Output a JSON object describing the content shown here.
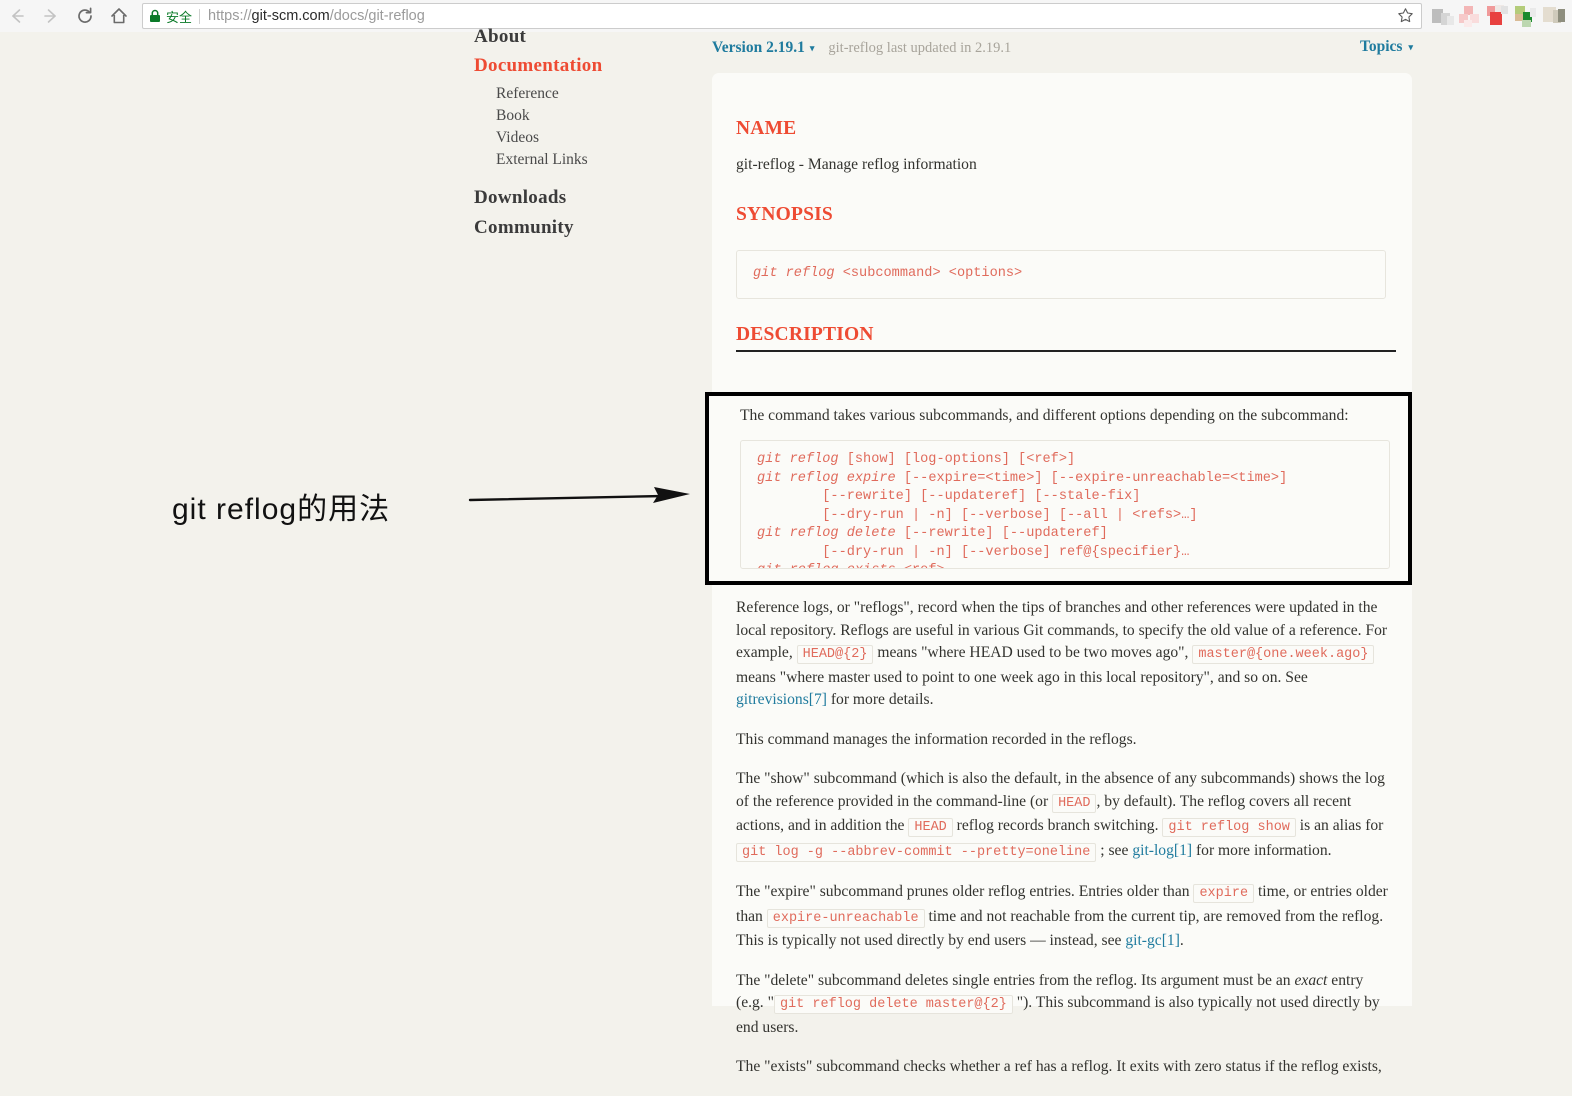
{
  "browser": {
    "back_icon": "back-arrow-icon",
    "forward_icon": "forward-arrow-icon",
    "reload_icon": "reload-icon",
    "home_icon": "home-icon",
    "lock_icon": "lock-icon",
    "secure_label": "安全",
    "url_prefix": "https://",
    "url_domain": "git-scm.com",
    "url_path": "/docs/git-reflog",
    "url_full": "https://git-scm.com/docs/git-reflog",
    "bookmark_icon": "star-icon"
  },
  "sidebar": {
    "items": [
      {
        "label": "About",
        "level": "top",
        "active": false
      },
      {
        "label": "Documentation",
        "level": "top",
        "active": true
      },
      {
        "label": "Reference",
        "level": "sub",
        "active": false
      },
      {
        "label": "Book",
        "level": "sub",
        "active": false
      },
      {
        "label": "Videos",
        "level": "sub",
        "active": false
      },
      {
        "label": "External Links",
        "level": "sub",
        "active": false
      },
      {
        "label": "Downloads",
        "level": "top",
        "active": false
      },
      {
        "label": "Community",
        "level": "top",
        "active": false
      }
    ]
  },
  "version_bar": {
    "version_label": "Version 2.19.1",
    "caret": "▾",
    "updated_note": "git-reflog last updated in 2.19.1",
    "topics_label": "Topics",
    "topics_caret": "▾"
  },
  "doc": {
    "name_heading": "NAME",
    "name_text": "git-reflog - Manage reflog information",
    "synopsis_heading": "SYNOPSIS",
    "synopsis_code_em": "git reflog",
    "synopsis_code_rest": " <subcommand> <options>",
    "description_heading": "DESCRIPTION",
    "description_intro": "The command takes various subcommands, and different options depending on the subcommand:",
    "description_code_lines": [
      "git reflog [show] [log-options] [<ref>]",
      "git reflog expire [--expire=<time>] [--expire-unreachable=<time>]",
      "        [--rewrite] [--updateref] [--stale-fix]",
      "        [--dry-run | -n] [--verbose] [--all | <refs>…]",
      "git reflog delete [--rewrite] [--updateref]",
      "        [--dry-run | -n] [--verbose] ref@{specifier}…",
      "git reflog exists <ref>"
    ],
    "para_reflogs": {
      "t1": "Reference logs, or \"reflogs\", record when the tips of branches and other references were updated in the local repository. Reflogs are useful in various Git commands, to specify the old value of a reference. For example, ",
      "c1": "HEAD@{2}",
      "t2": " means \"where HEAD used to be two moves ago\", ",
      "c2": "master@{one.week.ago}",
      "t3": " means \"where master used to point to one week ago in this local repository\", and so on. See ",
      "link": "gitrevisions[7]",
      "t4": " for more details."
    },
    "para_manages": "This command manages the information recorded in the reflogs.",
    "para_show": {
      "t1": "The \"show\" subcommand (which is also the default, in the absence of any subcommands) shows the log of the reference provided in the command-line (or ",
      "c1": "HEAD",
      "t2": ", by default). The reflog covers all recent actions, and in addition the ",
      "c2": "HEAD",
      "t3": " reflog records branch switching. ",
      "c3": "git reflog show",
      "t4": " is an alias for ",
      "c4": "git log -g --abbrev-commit --pretty=oneline",
      "t5": " ; see ",
      "link": "git-log[1]",
      "t6": " for more information."
    },
    "para_expire": {
      "t1": "The \"expire\" subcommand prunes older reflog entries. Entries older than ",
      "c1": "expire",
      "t2": " time, or entries older than ",
      "c2": "expire-unreachable",
      "t3": " time and not reachable from the current tip, are removed from the reflog. This is typically not used directly by end users — instead, see ",
      "link": "git-gc[1]",
      "t4": "."
    },
    "para_delete": {
      "t1": "The \"delete\" subcommand deletes single entries from the reflog. Its argument must be an ",
      "em1": "exact",
      "t2": " entry (e.g. \"",
      "c1": "git reflog delete master@{2}",
      "t3": " \"). This subcommand is also typically not used directly by end users."
    },
    "para_exists": "The \"exists\" subcommand checks whether a ref has a reflog. It exits with zero status if the reflog exists,"
  },
  "annotation": {
    "text": "git reflog的用法",
    "arrow_icon": "right-arrow-annotation-icon",
    "highlight_box_icon": "black-highlight-rectangle"
  },
  "colors": {
    "accent_red": "#ee4b33",
    "code_red": "#e06b5c",
    "link_blue": "#1f7b9e",
    "page_bg": "#f3f2ec",
    "panel_bg": "#fbfbf8",
    "secure_green": "#0b7a28"
  }
}
